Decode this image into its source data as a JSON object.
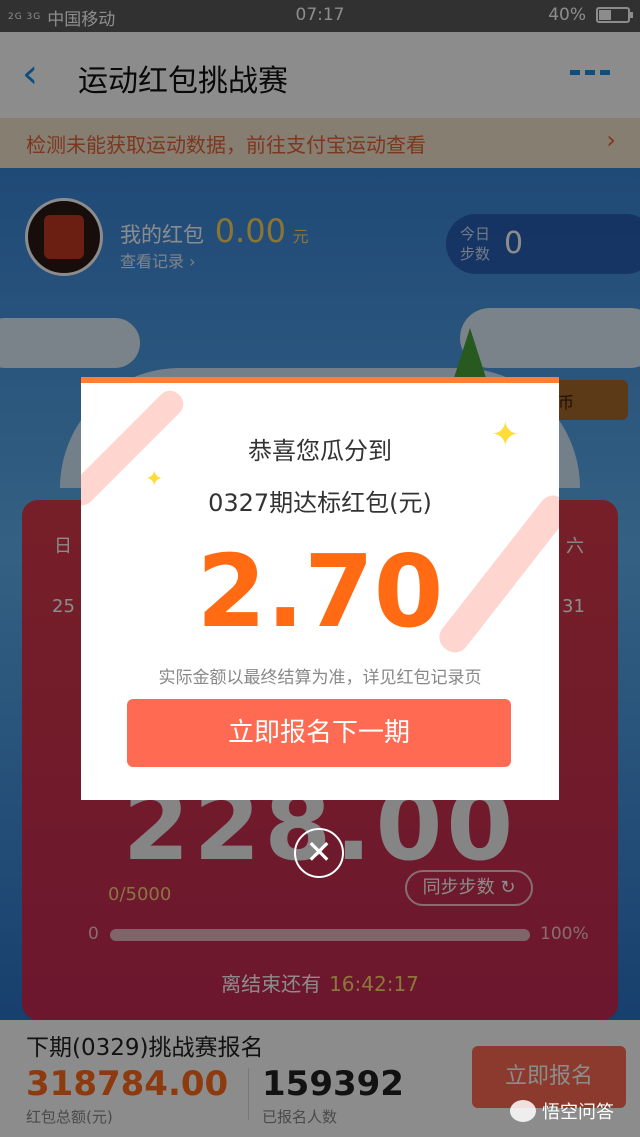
{
  "status_bar": {
    "signal": "2G 3G",
    "carrier": "中国移动",
    "time": "07:17",
    "battery": "40%"
  },
  "nav": {
    "back_icon": "chevron-left-icon",
    "title": "运动红包挑战赛",
    "more_icon": "more-dots-icon"
  },
  "notice": {
    "text": "检测未能获取运动数据，前往支付宝运动查看",
    "arrow": "›"
  },
  "header": {
    "my_red_label": "我的红包",
    "my_red_amount": "0.00",
    "my_red_unit": "元",
    "records_link": "查看记录 ›",
    "today_label": "今日\n步数",
    "today_value": "0"
  },
  "scene": {
    "coin_sign": "币"
  },
  "card": {
    "week_start": "日",
    "week_end": "六",
    "day_start": "25",
    "day_end": "31",
    "steps_display": "228.00",
    "progress_text": "0/5000",
    "sync_button": "同步步数 ↻",
    "progress_min": "0",
    "progress_max": "100%",
    "progress_fraction": 0,
    "countdown_label": "离结束还有",
    "countdown_time": "16:42:17"
  },
  "bottom": {
    "next_title": "下期(0329)挑战赛报名",
    "total_amount": "318784.00",
    "total_label": "红包总额(元)",
    "participants": "159392",
    "participants_label": "已报名人数",
    "signup_button": "立即报名"
  },
  "watermark": {
    "text": "悟空问答"
  },
  "modal": {
    "line1": "恭喜您瓜分到",
    "line2": "0327期达标红包(元)",
    "amount": "2.70",
    "note": "实际金额以最终结算为准，详见红包记录页",
    "button": "立即报名下一期",
    "close": "✕"
  },
  "colors": {
    "accent": "#ff6a52",
    "amount": "#ff6a12",
    "blue": "#1a8fe6"
  }
}
